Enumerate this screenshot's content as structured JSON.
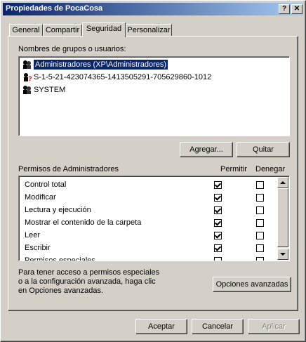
{
  "window": {
    "title": "Propiedades de PocaCosa",
    "help_glyph": "?",
    "close_glyph": "✕"
  },
  "tabs": [
    {
      "label": "General"
    },
    {
      "label": "Compartir"
    },
    {
      "label": "Seguridad",
      "active": true
    },
    {
      "label": "Personalizar"
    }
  ],
  "users": {
    "label": "Nombres de grupos o usuarios:",
    "items": [
      {
        "name": "Administradores (XP\\Administradores)",
        "selected": true,
        "icon": "group-icon"
      },
      {
        "name": "S-1-5-21-423074365-1413505291-705629860-1012",
        "selected": false,
        "icon": "unknown-user-icon"
      },
      {
        "name": "SYSTEM",
        "selected": false,
        "icon": "group-icon"
      }
    ]
  },
  "buttons": {
    "add": "Agregar...",
    "remove": "Quitar",
    "advanced": "Opciones avanzadas",
    "ok": "Aceptar",
    "cancel": "Cancelar",
    "apply": "Aplicar"
  },
  "permissions": {
    "label": "Permisos de Administradores",
    "allow_header": "Permitir",
    "deny_header": "Denegar",
    "rows": [
      {
        "name": "Control total",
        "allow": true,
        "deny": false
      },
      {
        "name": "Modificar",
        "allow": true,
        "deny": false
      },
      {
        "name": "Lectura y ejecución",
        "allow": true,
        "deny": false
      },
      {
        "name": "Mostrar el contenido de la carpeta",
        "allow": true,
        "deny": false
      },
      {
        "name": "Leer",
        "allow": true,
        "deny": false
      },
      {
        "name": "Escribir",
        "allow": true,
        "deny": false
      },
      {
        "name": "Permisos especiales",
        "allow": false,
        "deny": false
      }
    ]
  },
  "info_text": {
    "line1": "Para tener acceso a permisos especiales",
    "line2": "o a la configuración avanzada, haga clic",
    "line3": "en Opciones avanzadas."
  }
}
